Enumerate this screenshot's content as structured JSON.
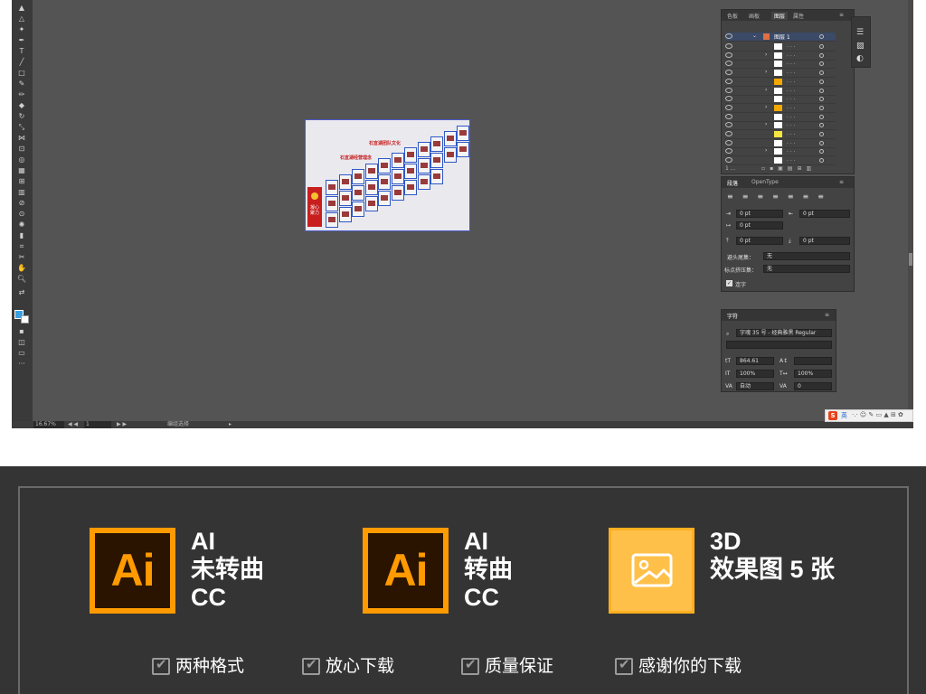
{
  "app": {
    "status_bar": {
      "zoom": "16.67%",
      "page": "1",
      "mode": "编组选择"
    }
  },
  "artboard": {
    "title_lines": [
      "石宜湖团队文化",
      "石宜湖经营理念"
    ],
    "banner_text": "凝心聚力"
  },
  "layers_panel": {
    "tabs": [
      "色板",
      "画板",
      "图层",
      "属性"
    ],
    "top_layer": "图层 1",
    "thumb_colors": [
      "#ffffff",
      "#ffffff",
      "#ffffff",
      "#ffffff",
      "#f5a800",
      "#ffffff",
      "#ffffff",
      "#f5a800",
      "#ffffff",
      "#ffffff",
      "#f5e642",
      "#ffffff",
      "#ffffff",
      "#ffffff"
    ],
    "footer": "1 ..."
  },
  "paragraph_panel": {
    "tabs": [
      "段落",
      "OpenType"
    ],
    "fields": [
      "0 pt",
      "0 pt",
      "0 pt",
      "0 pt",
      "0 pt"
    ],
    "kinsoku_label": "避头尾集：",
    "kinsoku_value": "无",
    "mojikumi_label": "标点挤压集：",
    "mojikumi_value": "无",
    "hyphenate_label": "连字"
  },
  "character_panel": {
    "title": "字符",
    "font": "字魂 35 号 - 经典雅黑 Regular",
    "size": "864.61",
    "vscale": "100%",
    "hscale": "100%",
    "tracking": "自动",
    "kerning": "0"
  },
  "tray": {
    "ime": "英"
  },
  "promo": {
    "items": [
      {
        "icon": "Ai",
        "lines": [
          "AI",
          "未转曲",
          "CC"
        ]
      },
      {
        "icon": "Ai",
        "lines": [
          "AI",
          "转曲",
          "CC"
        ]
      },
      {
        "icon": "image-icon",
        "lines": [
          "3D",
          "效果图 5 张"
        ]
      }
    ],
    "checks": [
      "两种格式",
      "放心下载",
      "质量保证",
      "感谢你的下载"
    ],
    "colors": {
      "accent": "#ff9a00",
      "dark": "#343434",
      "image_bg": "#ffc04a"
    }
  }
}
